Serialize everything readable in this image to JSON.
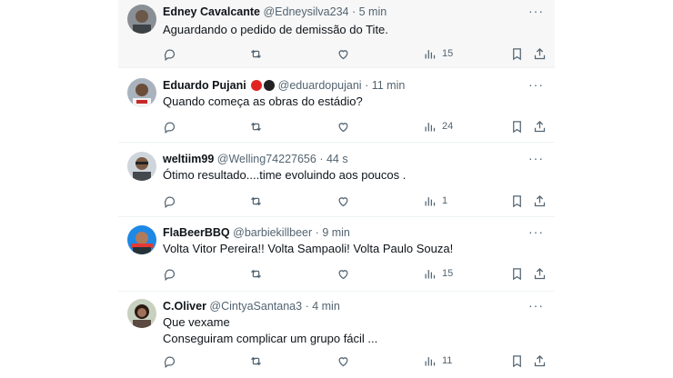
{
  "tweets": [
    {
      "name": "Edney Cavalcante",
      "handle": "@Edneysilva234",
      "time": "5 min",
      "text": "Aguardando o pedido de demissão do Tite.",
      "views": "15",
      "badges": []
    },
    {
      "name": "Eduardo Pujani",
      "handle": "@eduardopujani",
      "time": "11 min",
      "text": "Quando começa as obras do estádio?",
      "views": "24",
      "badges": [
        "#e02424",
        "#222222"
      ]
    },
    {
      "name": "weltiim99",
      "handle": "@Welling74227656",
      "time": "44 s",
      "text": "Ótimo resultado....time evoluindo aos poucos .",
      "views": "1",
      "badges": []
    },
    {
      "name": "FlaBeerBBQ",
      "handle": "@barbiekillbeer",
      "time": "9 min",
      "text": "Volta Vitor Pereira!! Volta Sampaoli! Volta Paulo Souza!",
      "views": "15",
      "badges": []
    },
    {
      "name": "C.Oliver",
      "handle": "@CintyaSantana3",
      "time": "4 min",
      "text": "Que vexame\nConseguiram complicar um grupo fácil ...",
      "views": "11",
      "badges": []
    }
  ],
  "icons": {
    "more": "more-horizontal-icon",
    "reply": "reply-icon",
    "retweet": "retweet-icon",
    "like": "like-icon",
    "views": "views-icon",
    "bookmark": "bookmark-icon",
    "share": "share-icon"
  },
  "colors": {
    "text": "#0f1419",
    "muted": "#536471",
    "border": "#eff3f4",
    "highlight": "#f7f7f7"
  }
}
